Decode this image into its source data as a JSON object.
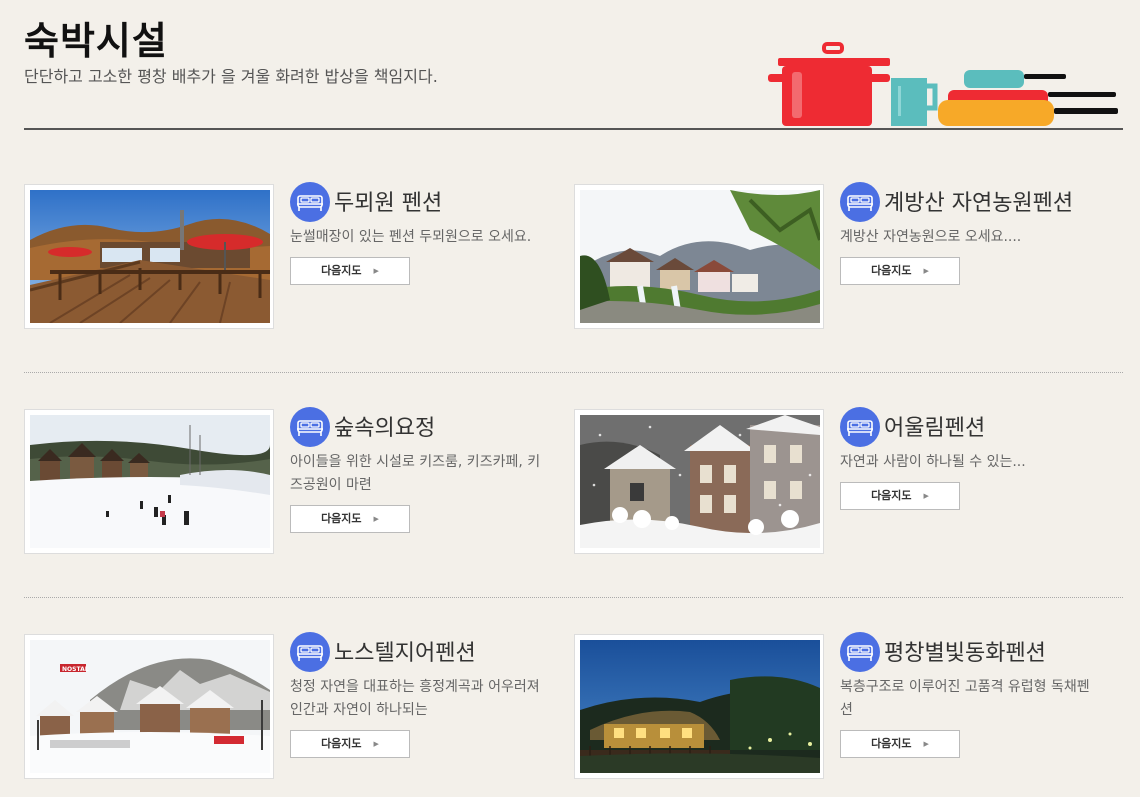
{
  "header": {
    "title": "숙박시설",
    "subtitle": "단단하고 고소한 평창 배추가 을 겨울 화려한 밥상을 책임지다."
  },
  "listings": [
    {
      "name": "두뫼원 펜션",
      "desc": "눈썰매장이 있는 펜션 두뫼원으로 오세요.",
      "button": "다음지도"
    },
    {
      "name": "계방산 자연농원펜션",
      "desc": "계방산 자연농원으로 오세요....",
      "button": "다음지도"
    },
    {
      "name": "숲속의요정",
      "desc": "아이들을 위한 시설로 키즈룸, 키즈카페, 키즈공원이 마련",
      "button": "다음지도"
    },
    {
      "name": "어울림펜션",
      "desc": "자연과 사람이 하나될 수 있는...",
      "button": "다음지도"
    },
    {
      "name": "노스텔지어펜션",
      "desc": "청정 자연을 대표하는 흥정계곡과 어우러져 인간과 자연이 하나되는",
      "button": "다음지도"
    },
    {
      "name": "평창별빛동화펜션",
      "desc": "복층구조로 이루어진 고품격 유럽형 독채펜션",
      "button": "다음지도"
    }
  ],
  "thumb_labels": {
    "nostal": "NOSTAL"
  },
  "icons": {
    "listing_icon": "bed-icon",
    "button_icon": "arrow-right-icon",
    "header_decor": "cookware-icon"
  },
  "colors": {
    "background": "#f3f0ea",
    "icon_bg": "#4b6fe3",
    "pot": "#ee2b33",
    "mug": "#5bbdbd",
    "pan": "#f7a928"
  }
}
